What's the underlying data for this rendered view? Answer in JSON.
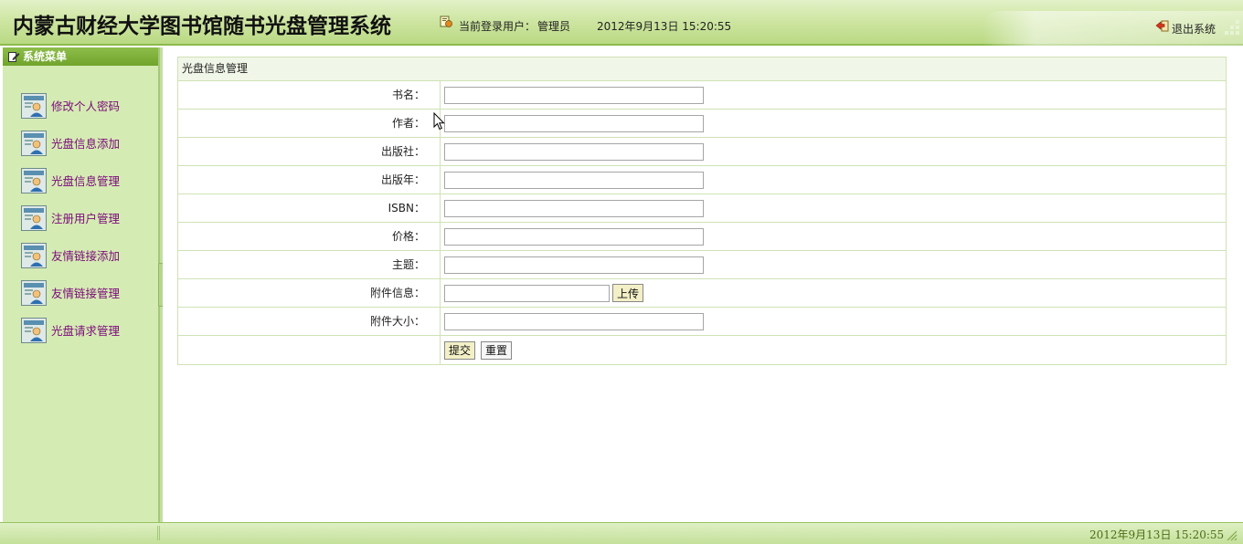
{
  "header": {
    "title": "内蒙古财经大学图书馆随书光盘管理系统",
    "user_label": "当前登录用户：",
    "user_name": "管理员",
    "datetime": "2012年9月13日  15:20:55",
    "logout_label": "退出系统"
  },
  "sidebar": {
    "heading": "系统菜单",
    "items": [
      {
        "label": "修改个人密码",
        "icon": "user-form-icon"
      },
      {
        "label": "光盘信息添加",
        "icon": "user-form-icon"
      },
      {
        "label": "光盘信息管理",
        "icon": "user-form-icon"
      },
      {
        "label": "注册用户管理",
        "icon": "user-form-icon"
      },
      {
        "label": "友情链接添加",
        "icon": "user-form-icon"
      },
      {
        "label": "友情链接管理",
        "icon": "user-form-icon"
      },
      {
        "label": "光盘请求管理",
        "icon": "user-form-icon"
      }
    ]
  },
  "form": {
    "panel_title": "光盘信息管理",
    "fields": {
      "book_title": {
        "label": "书名：",
        "value": ""
      },
      "author": {
        "label": "作者：",
        "value": ""
      },
      "publisher": {
        "label": "出版社：",
        "value": ""
      },
      "publish_year": {
        "label": "出版年：",
        "value": ""
      },
      "isbn": {
        "label": "ISBN：",
        "value": ""
      },
      "price": {
        "label": "价格：",
        "value": ""
      },
      "subject": {
        "label": "主题：",
        "value": ""
      },
      "attachment": {
        "label": "附件信息：",
        "value": ""
      },
      "attachment_size": {
        "label": "附件大小：",
        "value": ""
      }
    },
    "upload_label": "上传",
    "submit_label": "提交",
    "reset_label": "重置"
  },
  "footer": {
    "datetime": "2012年9月13日  15:20:55"
  },
  "colors": {
    "header_green": "#b9d983",
    "sidebar_bg": "#d5ebb4",
    "menu_text": "#7a0a7a",
    "border": "#cfe2b6"
  }
}
